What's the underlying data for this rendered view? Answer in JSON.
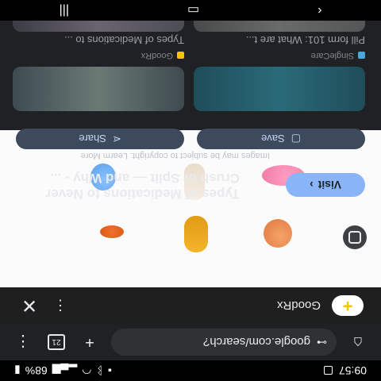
{
  "status_bar": {
    "time": "09:57",
    "battery": "68%"
  },
  "browser": {
    "url": "google.com/search?",
    "tab_count": "21"
  },
  "lens": {
    "site_name": "GoodRx",
    "result_title": "Types of Medications to Never Crush or Split — and Why - ...",
    "copyright_notice": "Images may be subject to copyright. Learm More",
    "visit_label": "Visit",
    "share_label": "Share",
    "save_label": "Save"
  },
  "related": [
    {
      "title": "Types of Medications to ...",
      "source": "GoodRx"
    },
    {
      "title": "Pill form 101: What are t...",
      "source": "SingleCare"
    },
    {
      "title": "",
      "source": ""
    },
    {
      "title": "",
      "source": ""
    }
  ],
  "colors": {
    "accent": "#8ab4f8",
    "visit_bg": "#8ab4f8",
    "logo_plus": "#f5c400",
    "sheet_bg": "#202124"
  },
  "icons": {
    "back": "back-arrow-icon",
    "home": "home-icon",
    "recents": "recents-icon",
    "lens": "lens-icon"
  }
}
